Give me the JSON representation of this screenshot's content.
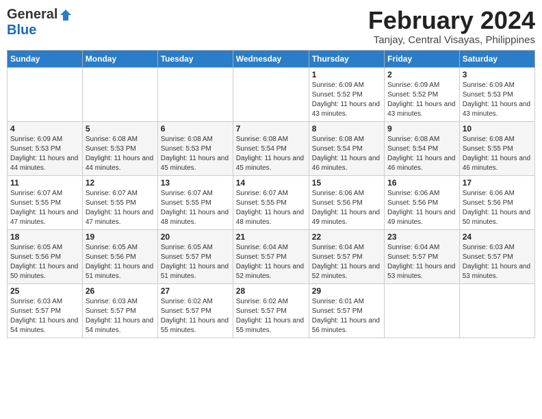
{
  "header": {
    "logo_general": "General",
    "logo_blue": "Blue",
    "month_title": "February 2024",
    "location": "Tanjay, Central Visayas, Philippines"
  },
  "days_of_week": [
    "Sunday",
    "Monday",
    "Tuesday",
    "Wednesday",
    "Thursday",
    "Friday",
    "Saturday"
  ],
  "weeks": [
    [
      {
        "day": "",
        "info": ""
      },
      {
        "day": "",
        "info": ""
      },
      {
        "day": "",
        "info": ""
      },
      {
        "day": "",
        "info": ""
      },
      {
        "day": "1",
        "info": "Sunrise: 6:09 AM\nSunset: 5:52 PM\nDaylight: 11 hours and 43 minutes."
      },
      {
        "day": "2",
        "info": "Sunrise: 6:09 AM\nSunset: 5:52 PM\nDaylight: 11 hours and 43 minutes."
      },
      {
        "day": "3",
        "info": "Sunrise: 6:09 AM\nSunset: 5:53 PM\nDaylight: 11 hours and 43 minutes."
      }
    ],
    [
      {
        "day": "4",
        "info": "Sunrise: 6:09 AM\nSunset: 5:53 PM\nDaylight: 11 hours and 44 minutes."
      },
      {
        "day": "5",
        "info": "Sunrise: 6:08 AM\nSunset: 5:53 PM\nDaylight: 11 hours and 44 minutes."
      },
      {
        "day": "6",
        "info": "Sunrise: 6:08 AM\nSunset: 5:53 PM\nDaylight: 11 hours and 45 minutes."
      },
      {
        "day": "7",
        "info": "Sunrise: 6:08 AM\nSunset: 5:54 PM\nDaylight: 11 hours and 45 minutes."
      },
      {
        "day": "8",
        "info": "Sunrise: 6:08 AM\nSunset: 5:54 PM\nDaylight: 11 hours and 46 minutes."
      },
      {
        "day": "9",
        "info": "Sunrise: 6:08 AM\nSunset: 5:54 PM\nDaylight: 11 hours and 46 minutes."
      },
      {
        "day": "10",
        "info": "Sunrise: 6:08 AM\nSunset: 5:55 PM\nDaylight: 11 hours and 46 minutes."
      }
    ],
    [
      {
        "day": "11",
        "info": "Sunrise: 6:07 AM\nSunset: 5:55 PM\nDaylight: 11 hours and 47 minutes."
      },
      {
        "day": "12",
        "info": "Sunrise: 6:07 AM\nSunset: 5:55 PM\nDaylight: 11 hours and 47 minutes."
      },
      {
        "day": "13",
        "info": "Sunrise: 6:07 AM\nSunset: 5:55 PM\nDaylight: 11 hours and 48 minutes."
      },
      {
        "day": "14",
        "info": "Sunrise: 6:07 AM\nSunset: 5:55 PM\nDaylight: 11 hours and 48 minutes."
      },
      {
        "day": "15",
        "info": "Sunrise: 6:06 AM\nSunset: 5:56 PM\nDaylight: 11 hours and 49 minutes."
      },
      {
        "day": "16",
        "info": "Sunrise: 6:06 AM\nSunset: 5:56 PM\nDaylight: 11 hours and 49 minutes."
      },
      {
        "day": "17",
        "info": "Sunrise: 6:06 AM\nSunset: 5:56 PM\nDaylight: 11 hours and 50 minutes."
      }
    ],
    [
      {
        "day": "18",
        "info": "Sunrise: 6:05 AM\nSunset: 5:56 PM\nDaylight: 11 hours and 50 minutes."
      },
      {
        "day": "19",
        "info": "Sunrise: 6:05 AM\nSunset: 5:56 PM\nDaylight: 11 hours and 51 minutes."
      },
      {
        "day": "20",
        "info": "Sunrise: 6:05 AM\nSunset: 5:57 PM\nDaylight: 11 hours and 51 minutes."
      },
      {
        "day": "21",
        "info": "Sunrise: 6:04 AM\nSunset: 5:57 PM\nDaylight: 11 hours and 52 minutes."
      },
      {
        "day": "22",
        "info": "Sunrise: 6:04 AM\nSunset: 5:57 PM\nDaylight: 11 hours and 52 minutes."
      },
      {
        "day": "23",
        "info": "Sunrise: 6:04 AM\nSunset: 5:57 PM\nDaylight: 11 hours and 53 minutes."
      },
      {
        "day": "24",
        "info": "Sunrise: 6:03 AM\nSunset: 5:57 PM\nDaylight: 11 hours and 53 minutes."
      }
    ],
    [
      {
        "day": "25",
        "info": "Sunrise: 6:03 AM\nSunset: 5:57 PM\nDaylight: 11 hours and 54 minutes."
      },
      {
        "day": "26",
        "info": "Sunrise: 6:03 AM\nSunset: 5:57 PM\nDaylight: 11 hours and 54 minutes."
      },
      {
        "day": "27",
        "info": "Sunrise: 6:02 AM\nSunset: 5:57 PM\nDaylight: 11 hours and 55 minutes."
      },
      {
        "day": "28",
        "info": "Sunrise: 6:02 AM\nSunset: 5:57 PM\nDaylight: 11 hours and 55 minutes."
      },
      {
        "day": "29",
        "info": "Sunrise: 6:01 AM\nSunset: 5:57 PM\nDaylight: 11 hours and 56 minutes."
      },
      {
        "day": "",
        "info": ""
      },
      {
        "day": "",
        "info": ""
      }
    ]
  ]
}
